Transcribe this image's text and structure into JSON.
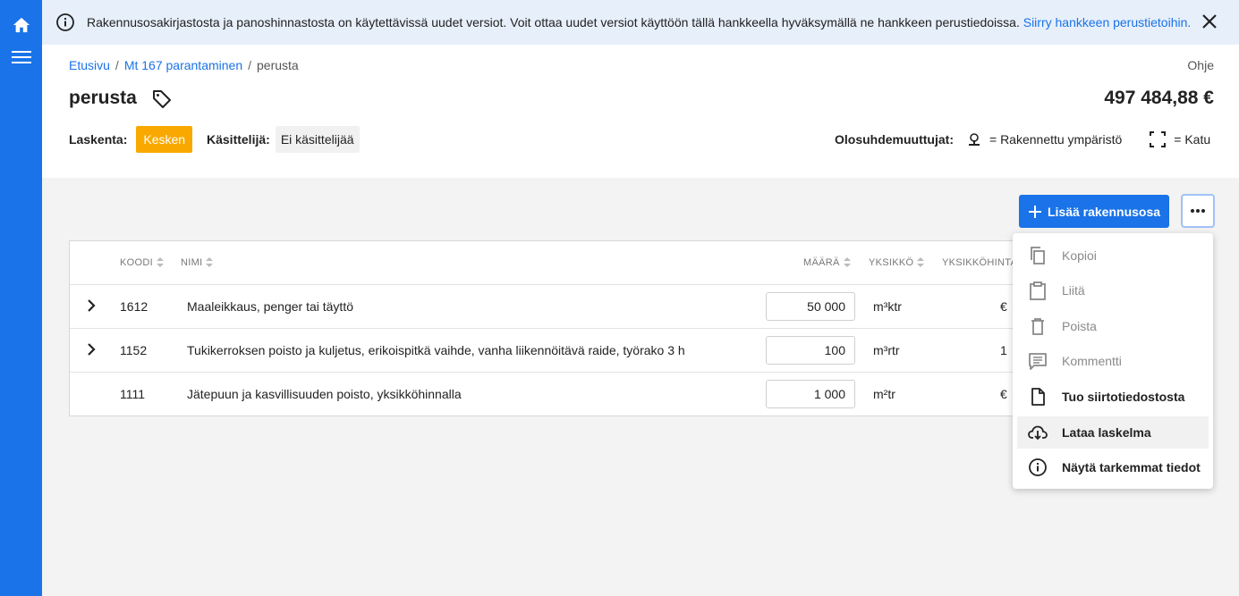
{
  "colors": {
    "brand": "#1a73e8",
    "status_in_progress": "#f9a800",
    "banner_bg": "#e7effa"
  },
  "rail": {
    "home_icon": "home-icon",
    "menu_icon": "hamburger-icon"
  },
  "banner": {
    "message": "Rakennusosakirjastosta ja panoshinnastosta on käytettävissä uudet versiot. Voit ottaa uudet versiot käyttöön tällä hankkeella hyväksymällä ne hankkeen perustiedoissa.",
    "link_text": "Siirry hankkeen perustietoihin."
  },
  "breadcrumb": {
    "items": [
      "Etusivu",
      "Mt 167 parantaminen",
      "perusta"
    ],
    "separator": "/"
  },
  "header": {
    "help": "Ohje",
    "title": "perusta",
    "total": "497 484,88 €",
    "calc_label": "Laskenta:",
    "calc_status": "Kesken",
    "handler_label": "Käsittelijä:",
    "handler_value": "Ei käsittelijää",
    "conditions_label": "Olosuhdemuuttujat:",
    "condition1": "= Rakennettu ympäristö",
    "condition2": "= Katu"
  },
  "toolbar": {
    "add_label": "Lisää rakennusosa"
  },
  "table": {
    "headers": {
      "code": "KOODI",
      "name": "NIMI",
      "qty": "MÄÄRÄ",
      "unit": "YKSIKKÖ",
      "unit_price": "YKSIKKÖHINTA"
    },
    "rows": [
      {
        "code": "1612",
        "name": "Maaleikkaus, penger tai täyttö",
        "qty": "50 000",
        "unit": "m³ktr",
        "unit_price": "€",
        "expandable": true
      },
      {
        "code": "1152",
        "name": "Tukikerroksen poisto ja kuljetus, erikoispitkä vaihde, vanha liikennöitävä raide, työrako 3 h",
        "qty": "100",
        "unit": "m³rtr",
        "unit_price": "1",
        "expandable": true
      },
      {
        "code": "1111",
        "name": "Jätepuun ja kasvillisuuden poisto, yksikköhinnalla",
        "qty": "1 000",
        "unit": "m²tr",
        "unit_price": "€",
        "expandable": false
      }
    ]
  },
  "menu": {
    "items": [
      {
        "label": "Kopioi",
        "icon": "copy-icon",
        "enabled": false
      },
      {
        "label": "Liitä",
        "icon": "paste-icon",
        "enabled": false
      },
      {
        "label": "Poista",
        "icon": "delete-icon",
        "enabled": false
      },
      {
        "label": "Kommentti",
        "icon": "comment-icon",
        "enabled": false
      },
      {
        "label": "Tuo siirtotiedostosta",
        "icon": "file-icon",
        "enabled": true
      },
      {
        "label": "Lataa laskelma",
        "icon": "cloud-download-icon",
        "enabled": true
      },
      {
        "label": "Näytä tarkemmat tiedot",
        "icon": "info-icon",
        "enabled": true
      }
    ]
  }
}
